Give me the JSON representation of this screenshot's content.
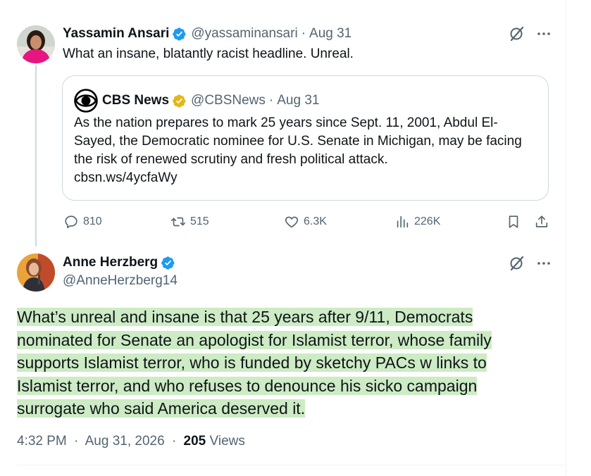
{
  "colors": {
    "text_primary": "#0f1419",
    "text_secondary": "#536471",
    "verified_blue": "#1d9bf0",
    "verified_gold": "#e2b719",
    "highlight": "#cdebc4",
    "thread_line": "#cfd9de"
  },
  "tweet1": {
    "author_name": "Yassamin Ansari",
    "author_handle": "@yassaminansari",
    "separator": "·",
    "date": "Aug 31",
    "text": "What an insane, blatantly racist headline. Unreal.",
    "avatar_icon": "user-avatar",
    "verified_icon": "verified-badge-icon",
    "grok_icon": "grok-icon",
    "more_icon": "more-icon"
  },
  "quoted_tweet": {
    "author_name": "CBS News",
    "author_handle": "@CBSNews",
    "separator": "·",
    "date": "Aug 31",
    "text": "As the nation prepares to mark 25 years since Sept. 11, 2001, Abdul El-Sayed, the Democratic nominee for U.S. Senate in Michigan, may be facing the risk of renewed scrutiny and fresh political attack.",
    "link": "cbsn.ws/4ycfaWy",
    "logo_icon": "cbs-eye-logo",
    "verified_icon": "gold-verified-badge-icon"
  },
  "engagement": {
    "replies": "810",
    "reposts": "515",
    "likes": "6.3K",
    "views": "226K"
  },
  "tweet2": {
    "author_name": "Anne Herzberg",
    "author_handle": "@AnneHerzberg14",
    "text": "What’s unreal and insane is that 25 years after 9/11, Democrats nominated for Senate an apologist for Islamist terror, whose family supports Islamist terror, who is funded by sketchy PACs w links to Islamist terror, and who refuses to denounce his sicko campaign surrogate who said America deserved it.",
    "time": "4:32 PM",
    "separator": "·",
    "date": "Aug 31, 2026",
    "view_count": "205",
    "views_label": "Views"
  }
}
